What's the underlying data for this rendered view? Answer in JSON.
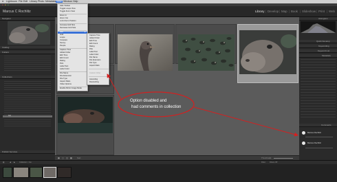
{
  "menubar": {
    "apple": "",
    "items": [
      "Lightroom",
      "File",
      "Edit",
      "Library",
      "Photo",
      "Metadata",
      "View",
      "Window",
      "Help"
    ],
    "active_index": 6
  },
  "identity": {
    "name": "Marcus C Rochlitz",
    "modules": [
      "Library",
      "Develop",
      "Map",
      "Book",
      "Slideshow",
      "Print",
      "Web"
    ],
    "selected_module": "Library"
  },
  "left_panel": {
    "navigator_label": "Navigator",
    "sections": [
      "Catalog",
      "Folders",
      "Collections",
      "Publish Services"
    ],
    "collection_selected": "zoo"
  },
  "right_panel": {
    "header": "Histogram",
    "sections": [
      "Quick Develop",
      "Keywording",
      "Keyword List",
      "Metadata",
      "Comments"
    ]
  },
  "view_menu": {
    "items": [
      {
        "label": "Hide Toolbar",
        "dim": false
      },
      {
        "label": "Toggle Loupe View",
        "dim": false
      },
      {
        "label": "Toggle Zoom View",
        "dim": false
      },
      {
        "label": "Zoom In",
        "dim": false
      },
      {
        "label": "Zoom Out",
        "dim": false
      },
      {
        "label": "Lock Zoom Position",
        "dim": false
      },
      {
        "label": "Increase Grid Size",
        "dim": false
      },
      {
        "label": "Decrease Grid Size",
        "dim": false
      },
      {
        "label": "Grid",
        "dim": false
      },
      {
        "label": "Loupe",
        "dim": false
      },
      {
        "label": "Compare",
        "dim": false
      },
      {
        "label": "Survey",
        "dim": false
      },
      {
        "label": "People",
        "dim": false
      },
      {
        "label": "Sort",
        "dim": false,
        "highlighted": true
      },
      {
        "label": "Capture Time",
        "dim": false
      },
      {
        "label": "Added Order",
        "dim": false
      },
      {
        "label": "Edit Time",
        "dim": false
      },
      {
        "label": "Edit Count",
        "dim": false
      },
      {
        "label": "Rating",
        "dim": false
      },
      {
        "label": "Pick",
        "dim": false
      },
      {
        "label": "Label Text",
        "dim": false
      },
      {
        "label": "Label Color",
        "dim": false
      },
      {
        "label": "File Name",
        "dim": false
      },
      {
        "label": "File Extension",
        "dim": false
      },
      {
        "label": "File Type",
        "dim": false
      },
      {
        "label": "Aspect Ratio",
        "dim": false
      },
      {
        "label": "Video Options",
        "dim": false
      },
      {
        "label": "Enable Mirror Image Mode",
        "dim": false
      }
    ]
  },
  "sort_submenu": {
    "items": [
      {
        "label": "Capture Time",
        "dim": false
      },
      {
        "label": "Added Order",
        "dim": false
      },
      {
        "label": "Edit Time",
        "dim": false
      },
      {
        "label": "Edit Count",
        "dim": false
      },
      {
        "label": "Rating",
        "dim": false
      },
      {
        "label": "Pick",
        "dim": false
      },
      {
        "label": "Label Text",
        "dim": false
      },
      {
        "label": "Label Color",
        "dim": false
      },
      {
        "label": "File Name",
        "dim": false
      },
      {
        "label": "File Extension",
        "dim": false
      },
      {
        "label": "File Type",
        "dim": false
      },
      {
        "label": "Aspect Ratio",
        "dim": false
      },
      {
        "label": "Custom Order",
        "dim": true
      },
      {
        "label": "Ascending",
        "dim": false
      },
      {
        "label": "Descending",
        "dim": false
      }
    ]
  },
  "annotation": {
    "line1": "Option disabled and",
    "line2": "had comments in collection",
    "color": "#d42020"
  },
  "comments": {
    "entries": [
      "Marcus Rochlitz",
      "Marcus Rochlitz"
    ]
  },
  "toolbar": {
    "sort_label": "Sort:",
    "thumbnails_label": "Thumbnails"
  },
  "filmstrip": {
    "source_text": "Collection : zoo",
    "filter_label": "Filter :",
    "filter_value": "Filters Off"
  }
}
